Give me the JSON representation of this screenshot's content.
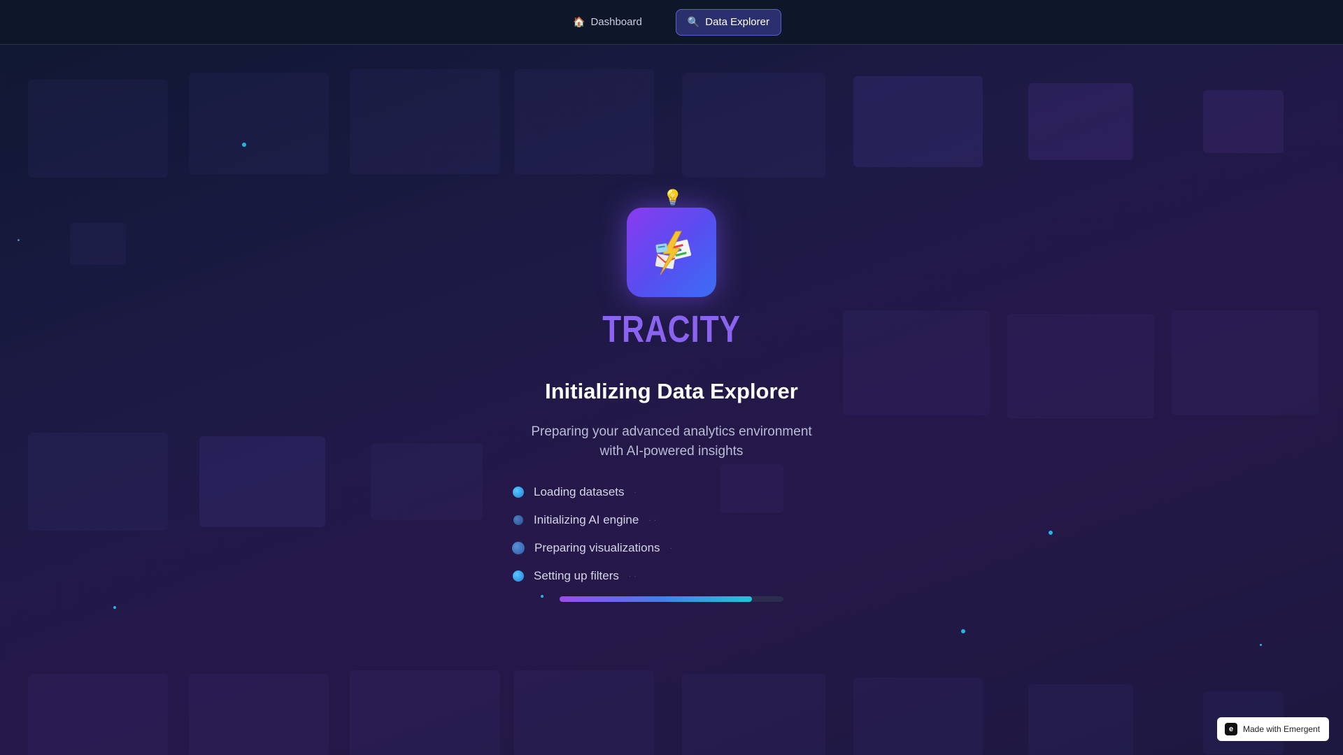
{
  "nav": {
    "items": [
      {
        "icon": "home-icon",
        "glyph": "🏠",
        "label": "Dashboard",
        "active": false
      },
      {
        "icon": "search-icon",
        "glyph": "🔍",
        "label": "Data Explorer",
        "active": true
      }
    ]
  },
  "loader": {
    "bulb_glyph": "💡",
    "brand": "TRACITY",
    "title": "Initializing Data Explorer",
    "subtitle_line1": "Preparing your advanced analytics environment",
    "subtitle_line2": "with AI-powered insights",
    "steps": [
      {
        "label": "Loading datasets"
      },
      {
        "label": "Initializing AI engine"
      },
      {
        "label": "Preparing visualizations"
      },
      {
        "label": "Setting up filters"
      }
    ],
    "progress_fraction": 0.86
  },
  "badge": {
    "label": "Made with Emergent",
    "logo_glyph": "e"
  },
  "colors": {
    "accent": "#8a63f0",
    "nav_active_bg": "#2a2f6e",
    "progress_start": "#9b4de8",
    "progress_end": "#1ec6d8"
  }
}
